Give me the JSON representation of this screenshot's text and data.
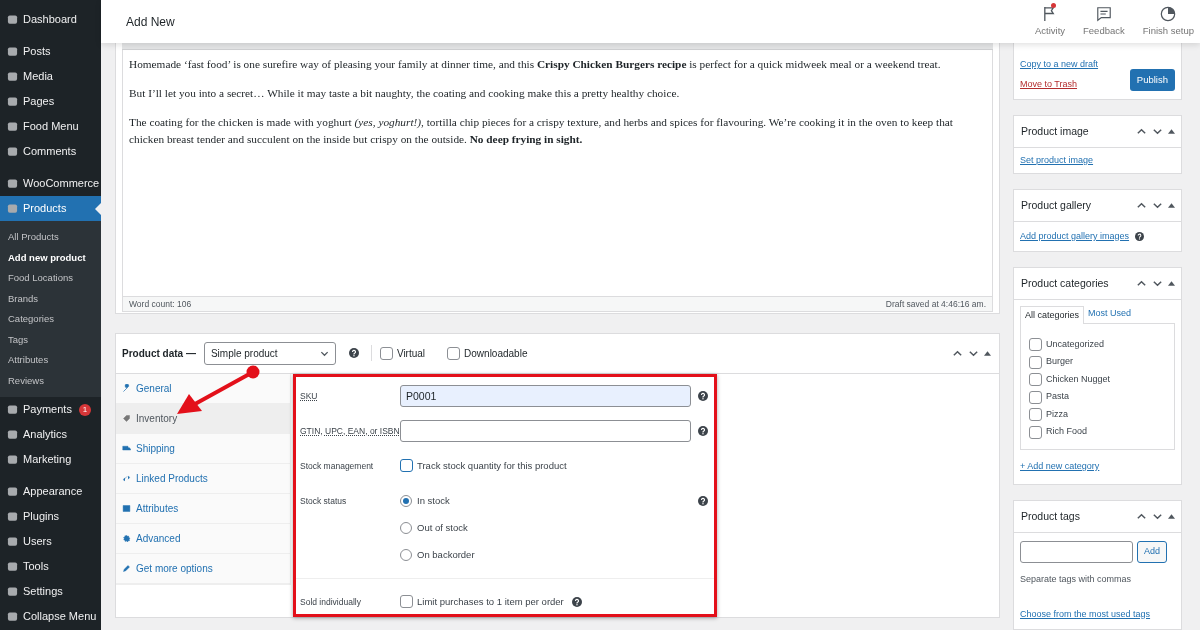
{
  "sidebar": {
    "groups": [
      [
        {
          "label": "Dashboard",
          "selected": false
        }
      ],
      [
        {
          "label": "Posts",
          "selected": false
        },
        {
          "label": "Media",
          "selected": false
        },
        {
          "label": "Pages",
          "selected": false
        },
        {
          "label": "Food Menu",
          "selected": false
        },
        {
          "label": "Comments",
          "selected": false
        }
      ],
      [
        {
          "label": "WooCommerce",
          "selected": false
        },
        {
          "label": "Products",
          "selected": true,
          "children": [
            {
              "label": "All Products",
              "selected": false
            },
            {
              "label": "Add new product",
              "selected": true
            },
            {
              "label": "Food Locations",
              "selected": false
            },
            {
              "label": "Brands",
              "selected": false
            },
            {
              "label": "Categories",
              "selected": false
            },
            {
              "label": "Tags",
              "selected": false
            },
            {
              "label": "Attributes",
              "selected": false
            },
            {
              "label": "Reviews",
              "selected": false
            }
          ]
        },
        {
          "label": "Payments",
          "selected": false,
          "badge": "1"
        },
        {
          "label": "Analytics",
          "selected": false
        },
        {
          "label": "Marketing",
          "selected": false
        }
      ],
      [
        {
          "label": "Appearance",
          "selected": false
        },
        {
          "label": "Plugins",
          "selected": false
        },
        {
          "label": "Users",
          "selected": false
        },
        {
          "label": "Tools",
          "selected": false
        },
        {
          "label": "Settings",
          "selected": false
        },
        {
          "label": "Collapse Menu",
          "selected": false
        }
      ]
    ]
  },
  "header": {
    "title": "Add New",
    "actions": [
      {
        "label": "Activity",
        "notification": true
      },
      {
        "label": "Feedback",
        "notification": false
      },
      {
        "label": "Finish setup",
        "notification": false
      }
    ]
  },
  "editor": {
    "paragraphs": [
      "Homemade ‘fast food’ is one surefire way of pleasing your family at dinner time, and this **Crispy Chicken Burgers recipe** is perfect for a quick midweek meal or a weekend treat.",
      "But I’ll let you into a secret… While it may taste a bit naughty, the coating and cooking make this a pretty healthy choice.",
      "The coating for the chicken is made with yoghurt *(yes, yoghurt!)*, tortilla chip pieces for a crispy texture, and herbs and spices for flavouring. We’re cooking it in the oven to keep that chicken breast tender and succulent on the inside but crispy on the outside. **No deep frying in sight.**"
    ],
    "word_count": "Word count: 106",
    "draft_status": "Draft saved at 4:46:16 am."
  },
  "product_data": {
    "title": "Product data —",
    "product_type": "Simple product",
    "options": [
      {
        "label": "Virtual",
        "checked": false
      },
      {
        "label": "Downloadable",
        "checked": false
      }
    ],
    "tabs": [
      {
        "label": "General",
        "selected": false
      },
      {
        "label": "Inventory",
        "selected": true
      },
      {
        "label": "Shipping",
        "selected": false
      },
      {
        "label": "Linked Products",
        "selected": false
      },
      {
        "label": "Attributes",
        "selected": false
      },
      {
        "label": "Advanced",
        "selected": false
      },
      {
        "label": "Get more options",
        "selected": false
      }
    ],
    "highlighted": true,
    "field_groups": [
      [
        {
          "kind": "text",
          "label": "SKU",
          "hint": true,
          "value": "P0001",
          "autofilled": true,
          "help": true
        },
        {
          "kind": "text",
          "label": "GTIN, UPC, EAN, or ISBN",
          "hint": true,
          "autofilled": false,
          "help": true
        },
        {
          "kind": "checkbox",
          "label": "Stock management",
          "option": "Track stock quantity for this product",
          "checked": false,
          "focused": true
        },
        {
          "kind": "radio",
          "label": "Stock status",
          "help": true,
          "options": [
            {
              "label": "In stock",
              "selected": true
            },
            {
              "label": "Out of stock",
              "selected": false
            },
            {
              "label": "On backorder",
              "selected": false
            }
          ]
        }
      ],
      [
        {
          "kind": "checkbox",
          "label": "Sold individually",
          "option": "Limit purchases to 1 item per order",
          "checked": false,
          "focused": false,
          "help": true
        }
      ]
    ]
  },
  "annotations": [
    {
      "kind": "arrow"
    }
  ],
  "publish": {
    "links": [
      {
        "kind": "link",
        "label": "Copy to a new draft"
      },
      {
        "kind": "danger",
        "label": "Move to Trash"
      }
    ],
    "button": "Publish"
  },
  "meta_boxes": [
    {
      "kind": "image",
      "title": "Product image",
      "link": "Set product image"
    },
    {
      "kind": "gallery",
      "title": "Product gallery",
      "link": "Add product gallery images",
      "help": true
    },
    {
      "kind": "categories",
      "title": "Product categories",
      "tabs": [
        {
          "label": "All categories",
          "selected": true
        },
        {
          "label": "Most Used",
          "selected": false
        }
      ],
      "items": [
        {
          "label": "Uncategorized",
          "checked": false
        },
        {
          "label": "Burger",
          "checked": false
        },
        {
          "label": "Chicken Nugget",
          "checked": false
        },
        {
          "label": "Pasta",
          "checked": false
        },
        {
          "label": "Pizza",
          "checked": false
        },
        {
          "label": "Rich Food",
          "checked": false
        }
      ],
      "link": "+ Add new category"
    },
    {
      "kind": "tags",
      "title": "Product tags",
      "button": "Add",
      "hint": "Separate tags with commas",
      "link": "Choose from the most used tags"
    }
  ]
}
